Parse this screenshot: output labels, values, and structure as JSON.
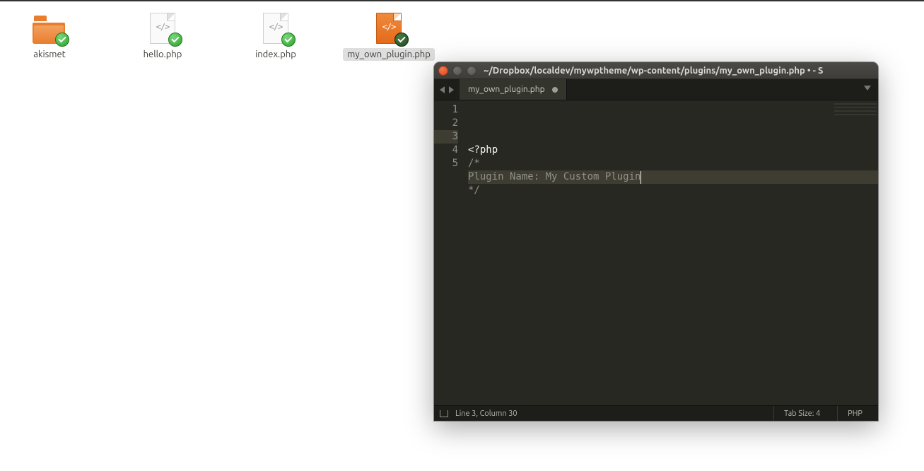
{
  "files": [
    {
      "name": "akismet",
      "type": "folder"
    },
    {
      "name": "hello.php",
      "type": "php-gray"
    },
    {
      "name": "index.php",
      "type": "php-gray"
    },
    {
      "name": "my_own_plugin.php",
      "type": "php-orange",
      "selected": true
    }
  ],
  "editor": {
    "title": "~/Dropbox/localdev/mywptheme/wp-content/plugins/my_own_plugin.php • - S",
    "tab": {
      "label": "my_own_plugin.php",
      "dirty": true
    },
    "lines": [
      {
        "n": "1",
        "text": "<?php",
        "cls": "kw"
      },
      {
        "n": "2",
        "text": "/*",
        "cls": "comment"
      },
      {
        "n": "3",
        "text": "Plugin Name: My Custom Plugin",
        "cls": "comment",
        "hl": true,
        "cursor": true
      },
      {
        "n": "4",
        "text": "*/",
        "cls": "comment"
      },
      {
        "n": "5",
        "text": "",
        "cls": "kw"
      }
    ],
    "status": {
      "position": "Line 3, Column 30",
      "tabsize": "Tab Size: 4",
      "lang": "PHP"
    }
  },
  "code_glyph": "</>"
}
